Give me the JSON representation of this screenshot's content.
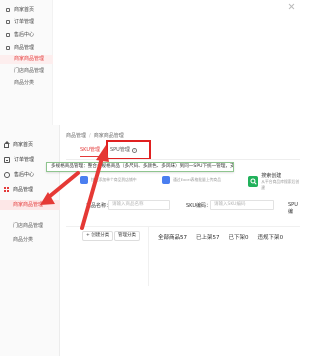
{
  "top_view": {
    "sidebar": {
      "items": [
        {
          "label": "商家首页",
          "icon": "home-icon"
        },
        {
          "label": "订单管理",
          "icon": "order-icon"
        },
        {
          "label": "售后中心",
          "icon": "after-sales-icon"
        },
        {
          "label": "商品管理",
          "icon": "grid-icon"
        }
      ],
      "subitems": [
        "商家商品管理",
        "门店商品管理",
        "商品分类"
      ]
    }
  },
  "sidebar": {
    "items": [
      {
        "label": "商家首页",
        "icon": "home-icon"
      },
      {
        "label": "订单管理",
        "icon": "order-icon"
      },
      {
        "label": "售后中心",
        "icon": "after-sales-icon"
      },
      {
        "label": "商品管理",
        "icon": "grid-icon"
      }
    ],
    "subitems": [
      "商家商品管理",
      "门店商品管理",
      "商品分类"
    ]
  },
  "breadcrumb": {
    "parent": "商品管理",
    "separator": "/",
    "current": "商家商品管理"
  },
  "tabs": [
    {
      "label": "SKU管理",
      "active": true
    },
    {
      "label": "SPU管理",
      "active": false
    }
  ],
  "tooltip": {
    "text": "多规格商品管理：整合多规格商品（多尺码、多颜色、多风味）到同一SPU下统一管理，支持SPU批量编辑，商品与SPU同步更新"
  },
  "cards": [
    {
      "title": "",
      "desc": "快速添加单个商品到店铺中"
    },
    {
      "title": "",
      "desc": "通过Excel表格批量上传商品"
    },
    {
      "title": "搜索创建",
      "desc": "从平台商品库搜索后创建"
    }
  ],
  "filters": {
    "name_label": "商品名称：",
    "name_placeholder": "请输入商品名称",
    "sku_label": "SKU编码：",
    "sku_placeholder": "请输入SKU编码",
    "spu_label": "SPU编"
  },
  "actions": {
    "create_label": "+ 创建分类",
    "manage_label": "管理分类"
  },
  "counts": [
    {
      "label": "全部商品",
      "value": "57"
    },
    {
      "label": "已上架",
      "value": "57"
    },
    {
      "label": "已下架",
      "value": "0"
    },
    {
      "label": "违规下架",
      "value": "0"
    }
  ],
  "colors": {
    "accent": "#e43a3a",
    "highlight_border": "#e02020",
    "tooltip_border": "#8fc58f"
  }
}
